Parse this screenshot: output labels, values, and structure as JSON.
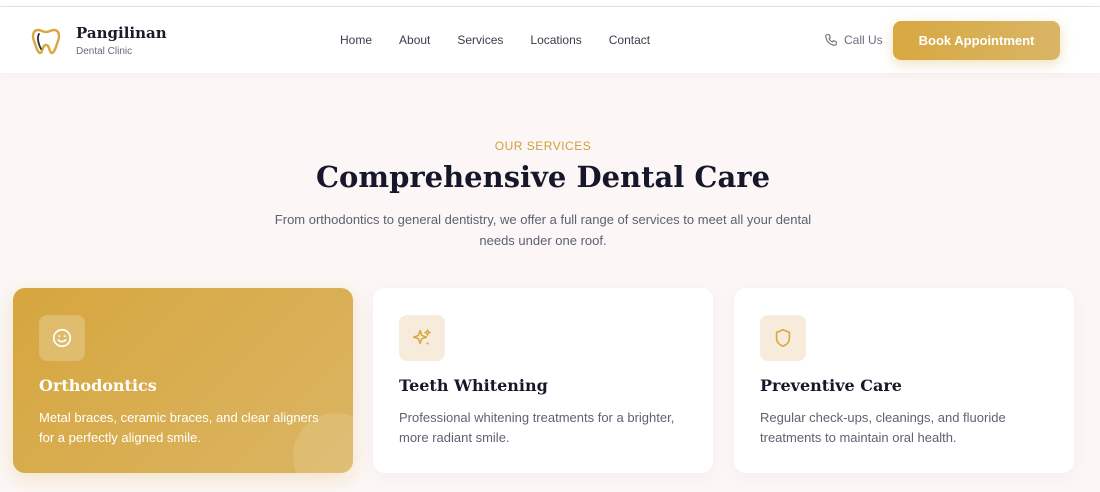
{
  "brand": {
    "name": "Pangilinan",
    "subtitle": "Dental Clinic"
  },
  "nav": [
    "Home",
    "About",
    "Services",
    "Locations",
    "Contact"
  ],
  "header_actions": {
    "call_label": "Call Us",
    "book_label": "Book Appointment"
  },
  "section": {
    "eyebrow": "OUR SERVICES",
    "title": "Comprehensive Dental Care",
    "description": "From orthodontics to general dentistry, we offer a full range of services to meet all your dental needs under one roof."
  },
  "services": [
    {
      "icon": "smile-icon",
      "title": "Orthodontics",
      "description": "Metal braces, ceramic braces, and clear aligners for a perfectly aligned smile."
    },
    {
      "icon": "sparkles-icon",
      "title": "Teeth Whitening",
      "description": "Professional whitening treatments for a brighter, more radiant smile."
    },
    {
      "icon": "shield-icon",
      "title": "Preventive Care",
      "description": "Regular check-ups, cleanings, and fluoride treatments to maintain oral health."
    }
  ],
  "colors": {
    "accent": "#d8a841",
    "background": "#fcf7f6",
    "heading": "#16172a"
  }
}
